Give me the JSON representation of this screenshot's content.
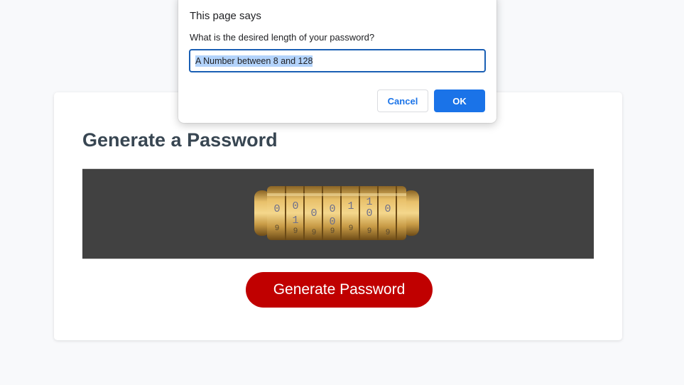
{
  "dialog": {
    "title": "This page says",
    "message": "What is the desired length of your password?",
    "input_value": "A Number between 8 and 128",
    "cancel_label": "Cancel",
    "ok_label": "OK"
  },
  "card": {
    "title": "Generate a Password",
    "button_label": "Generate Password",
    "image_icon": "cryptex-lock-icon"
  },
  "colors": {
    "page_bg": "#f8f9fb",
    "title_text": "#384652",
    "image_bg": "#414141",
    "generate_button": "#c00000",
    "ok_button": "#1a73e8",
    "input_focus": "#1a5fb4",
    "text_selection": "#b3d3fb"
  }
}
